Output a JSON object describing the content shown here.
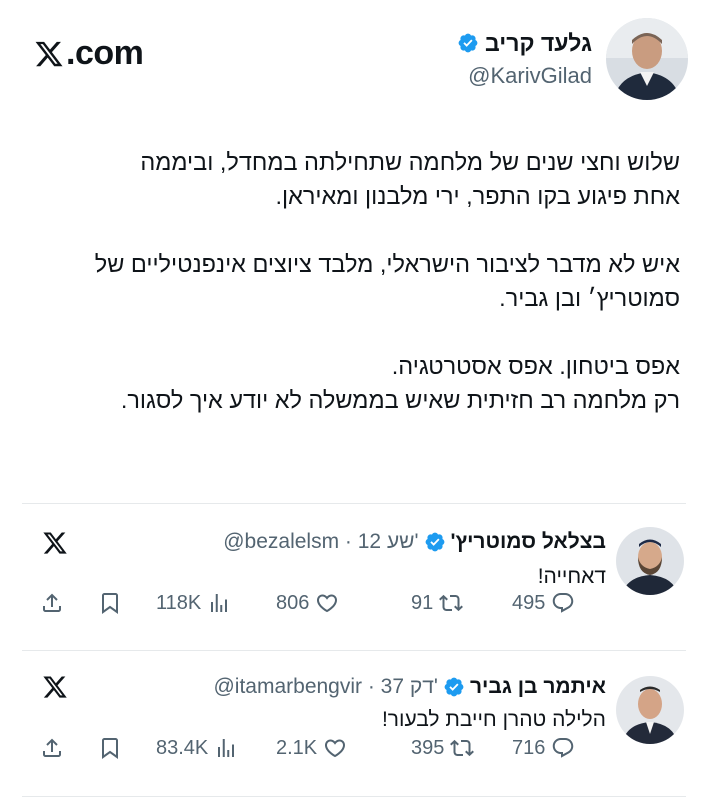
{
  "brand": {
    "label": ".com"
  },
  "main_tweet": {
    "author_name": "גלעד קריב",
    "handle": "@KarivGilad",
    "paragraphs": [
      [
        "שלוש וחצי שנים של מלחמה שתחילתה במחדל, וביממה",
        "אחת פיגוע בקו התפר, ירי מלבנון ומאיראן."
      ],
      [
        "איש לא מדבר לציבור הישראלי, מלבד ציוצים אינפנטיליים של",
        "סמוטריץ׳ ובן גביר."
      ],
      [
        "אפס ביטחון. אפס אסטרטגיה.",
        "רק מלחמה רב חזיתית שאיש בממשלה לא יודע איך לסגור."
      ]
    ]
  },
  "quoted": [
    {
      "name": "בצלאל סמוטריץ'",
      "meta": "@bezalelsm · 12 שע'",
      "text": "דאחייה!",
      "replies": "495",
      "retweets": "91",
      "likes": "806",
      "views": "118K"
    },
    {
      "name": "איתמר בן גביר",
      "meta": "@itamarbengvir · 37 דק'",
      "text": "הלילה טהרן חייבת לבעור!",
      "replies": "716",
      "retweets": "395",
      "likes": "2.1K",
      "views": "83.4K"
    }
  ],
  "colors": {
    "verified": "#1d9bf0",
    "muted": "#536471",
    "text": "#0f1419"
  }
}
